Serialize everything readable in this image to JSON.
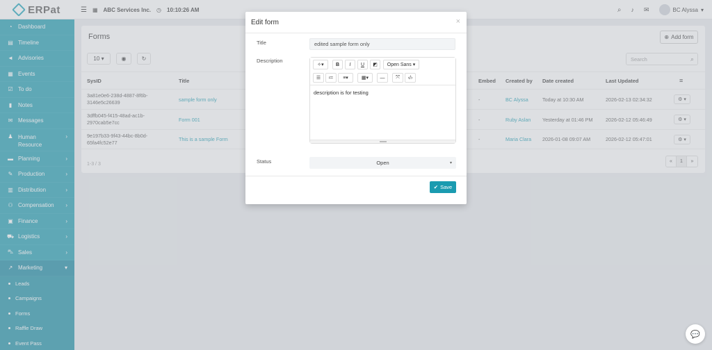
{
  "app": {
    "name": "ERPat",
    "company": "ABC Services Inc.",
    "time": "10:10:26 AM",
    "user": "BC Alyssa"
  },
  "sidebar": {
    "items": [
      {
        "label": "Dashboard",
        "icon": "tachometer"
      },
      {
        "label": "Timeline",
        "icon": "list-alt"
      },
      {
        "label": "Advisories",
        "icon": "bullhorn"
      },
      {
        "label": "Events",
        "icon": "calendar"
      },
      {
        "label": "To do",
        "icon": "check-square"
      },
      {
        "label": "Notes",
        "icon": "book"
      },
      {
        "label": "Messages",
        "icon": "envelope"
      },
      {
        "label": "Human Resource",
        "icon": "users"
      },
      {
        "label": "Planning",
        "icon": "briefcase"
      },
      {
        "label": "Production",
        "icon": "tools"
      },
      {
        "label": "Distribution",
        "icon": "university"
      },
      {
        "label": "Compensation",
        "icon": "handshake"
      },
      {
        "label": "Finance",
        "icon": "money"
      },
      {
        "label": "Logistics",
        "icon": "truck"
      },
      {
        "label": "Sales",
        "icon": "cart"
      },
      {
        "label": "Marketing",
        "icon": "chart-line"
      }
    ],
    "sub_items": [
      {
        "label": "Leads"
      },
      {
        "label": "Campaigns"
      },
      {
        "label": "Forms"
      },
      {
        "label": "Raffle Draw"
      },
      {
        "label": "Event Pass"
      }
    ]
  },
  "page": {
    "title": "Forms",
    "add_button": "Add form",
    "page_size": "10",
    "search_placeholder": "Search",
    "columns": [
      "SysID",
      "Title",
      "Embed",
      "Created by",
      "Date created",
      "Last Updated"
    ],
    "rows": [
      {
        "sysid": "3a81e0e6-238d-4887-8f6b-3146e5c26639",
        "title": "sample form only",
        "embed": "-",
        "created_by": "BC Alyssa",
        "date_created": "Today at 10:30 AM",
        "last_updated": "2026-02-13 02:34:32"
      },
      {
        "sysid": "3dffb045-f415-48ad-ac1b-2970cab5e7cc",
        "title": "Form 001",
        "embed": "-",
        "created_by": "Ruby Aslan",
        "date_created": "Yesterday at 01:46 PM",
        "last_updated": "2026-02-12 05:46:49"
      },
      {
        "sysid": "9e197b33-9f43-44bc-8b0d-65fa4fc52e77",
        "title": "This is a sample Form",
        "embed": "-",
        "created_by": "Maria Clara",
        "date_created": "2026-01-08 09:07 AM",
        "last_updated": "2026-02-12 05:47:01"
      }
    ],
    "pager_info": "1-3 / 3",
    "pager": {
      "prev": "«",
      "current": "1",
      "next": "»"
    }
  },
  "modal": {
    "title": "Edit form",
    "title_label": "Title",
    "title_value": "edited sample form only",
    "description_label": "Description",
    "font": "Open Sans",
    "description_value": "description is for testing",
    "status_label": "Status",
    "status_value": "Open",
    "save_label": "Save"
  },
  "colors": {
    "accent": "#1a9bb0",
    "sidebar": "#1a9bb0"
  }
}
